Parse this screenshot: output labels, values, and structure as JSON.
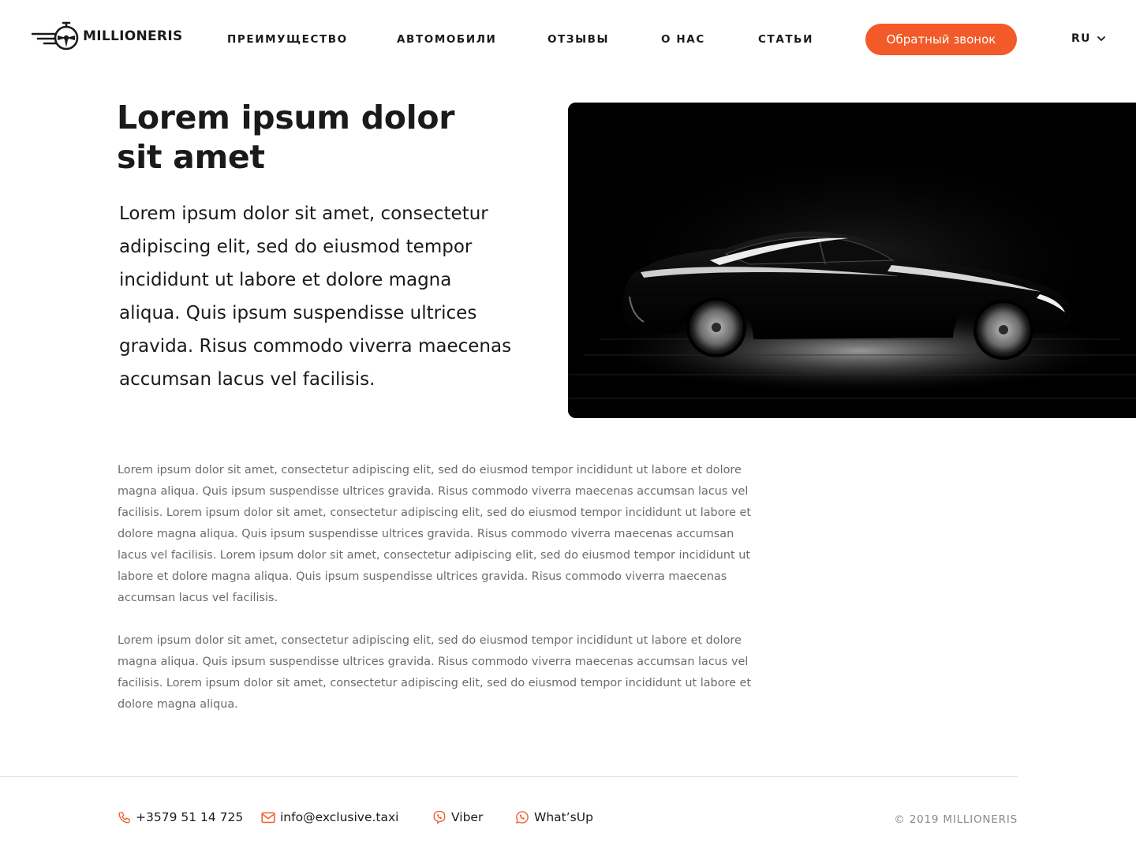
{
  "brand": {
    "name": "MILLIONERIS",
    "accent": "#f25a29"
  },
  "nav": {
    "items": [
      {
        "label": "ПРЕИМУЩЕСТВО"
      },
      {
        "label": "АВТОМОБИЛИ"
      },
      {
        "label": "ОТЗЫВЫ"
      },
      {
        "label": "О НАС"
      },
      {
        "label": "СТАТЬИ"
      }
    ],
    "cta_label": "Обратный звонок",
    "language": "RU"
  },
  "hero": {
    "title_line1": "Lorem ipsum dolor",
    "title_line2": "sit amet",
    "lead": "Lorem ipsum dolor sit amet, consectetur adipiscing elit, sed do eiusmod tempor incididunt ut labore et dolore magna aliqua. Quis ipsum suspendisse ultrices gravida. Risus commodo viverra maecenas accumsan lacus vel facilisis.",
    "image_icon": "black-sedan-car-photo"
  },
  "body": {
    "paragraph1": "Lorem ipsum dolor sit amet, consectetur adipiscing elit, sed do eiusmod tempor incididunt ut labore et dolore magna aliqua. Quis ipsum suspendisse ultrices gravida. Risus commodo viverra maecenas accumsan lacus vel facilisis. Lorem ipsum dolor sit amet, consectetur adipiscing elit, sed do eiusmod tempor incididunt ut labore et dolore magna aliqua. Quis ipsum suspendisse ultrices gravida. Risus commodo viverra maecenas accumsan lacus vel facilisis. Lorem ipsum dolor sit amet, consectetur adipiscing elit, sed do eiusmod tempor incididunt ut labore et dolore magna aliqua. Quis ipsum suspendisse ultrices gravida. Risus commodo viverra maecenas accumsan lacus vel facilisis.",
    "paragraph2": "Lorem ipsum dolor sit amet, consectetur adipiscing elit, sed do eiusmod tempor incididunt ut labore et dolore magna aliqua. Quis ipsum suspendisse ultrices gravida. Risus commodo viverra maecenas accumsan lacus vel facilisis. Lorem ipsum dolor sit amet, consectetur adipiscing elit, sed do eiusmod tempor incididunt ut labore et dolore magna aliqua."
  },
  "footer": {
    "phone": "+3579 51 14 725",
    "email": "info@exclusive.taxi",
    "viber": "Viber",
    "whatsapp": "What’sUp",
    "copyright": "© 2019 MILLIONERIS",
    "icons": [
      "phone-icon",
      "mail-icon",
      "viber-icon",
      "whatsapp-icon"
    ]
  }
}
